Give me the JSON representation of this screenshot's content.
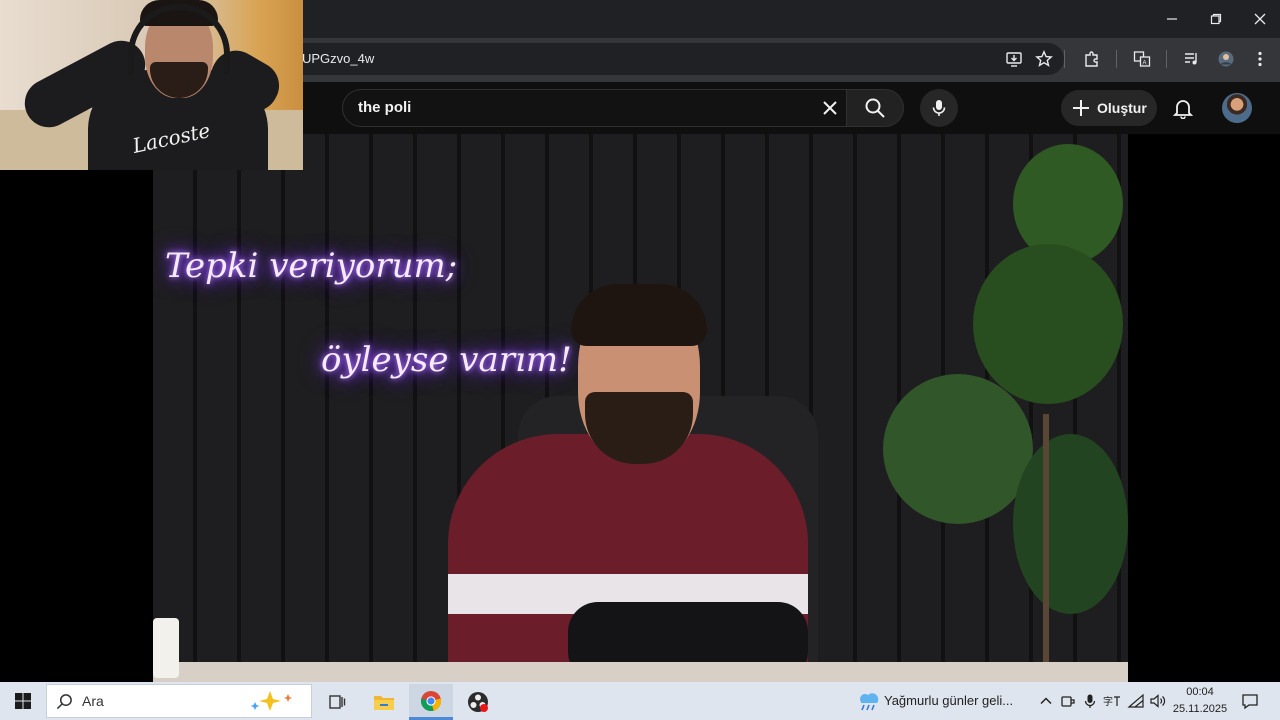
{
  "browser": {
    "url_fragment": "UPGzvo_4w",
    "window_controls": [
      "minimize",
      "restore",
      "close"
    ],
    "toolbar_icons": [
      "install-app-icon",
      "bookmark-star-icon",
      "extensions-icon",
      "translate-icon",
      "media-controls-icon",
      "profile-icon",
      "menu-icon"
    ]
  },
  "youtube": {
    "search_query": "the poli",
    "create_label": "Oluştur",
    "icons": [
      "clear-icon",
      "search-icon",
      "mic-icon",
      "plus-icon",
      "bell-icon"
    ]
  },
  "video": {
    "neon_line1": "Tepki veriyorum;",
    "neon_line2": "öyleyse varım!"
  },
  "webcam": {
    "shirt_logo": "Lacoste"
  },
  "taskbar": {
    "search_placeholder": "Ara",
    "weather_text": "Yağmurlu günler geli...",
    "time": "00:04",
    "date": "25.11.2025",
    "apps": [
      "task-view",
      "file-explorer",
      "chrome",
      "obs"
    ]
  },
  "colors": {
    "browser_bg": "#202124",
    "youtube_bg": "#0f0f0f",
    "taskbar_bg": "#dfe5ee",
    "neon": "#8a3dff"
  }
}
